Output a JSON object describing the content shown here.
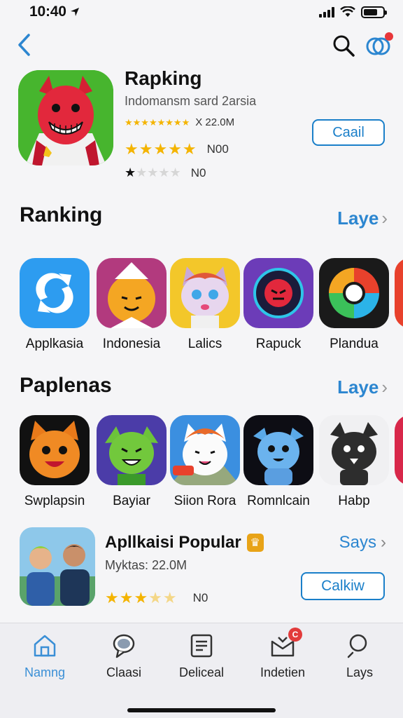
{
  "status": {
    "time": "10:40"
  },
  "featured": {
    "title": "Rapking",
    "subtitle": "Indomansm sard 2arsia",
    "meta_text": "X 22.0M",
    "rating_label": "N00",
    "rating2_label": "N0",
    "get_label": "Caail",
    "rating_value": 5
  },
  "section1": {
    "title": "Ranking",
    "link_label": "Laye",
    "apps": [
      {
        "label": "Applkasia",
        "icon": "refresh-icon"
      },
      {
        "label": "Indonesia",
        "icon": "tiger-icon"
      },
      {
        "label": "Lalics",
        "icon": "cat-icon"
      },
      {
        "label": "Rapuck",
        "icon": "mask-icon"
      },
      {
        "label": "Plandua",
        "icon": "swirl-icon"
      }
    ]
  },
  "section2": {
    "title": "Paplenas",
    "link_label": "Laye",
    "apps": [
      {
        "label": "Swplapsin",
        "icon": "fox-icon"
      },
      {
        "label": "Bayiar",
        "icon": "goblin-icon"
      },
      {
        "label": "Siion Rora",
        "icon": "kitten-icon"
      },
      {
        "label": "Romnlcain",
        "icon": "monster-icon"
      },
      {
        "label": "Habp",
        "icon": "bat-icon"
      }
    ]
  },
  "popular": {
    "title": "Apllkaisi Popular",
    "meta": "Myktas: 22.0M",
    "rating_label": "N0",
    "link_label": "Says",
    "button_label": "Calkiw",
    "rating_value": 3.5
  },
  "tabs": [
    {
      "label": "Namng",
      "icon": "home-icon",
      "active": true
    },
    {
      "label": "Claasi",
      "icon": "chat-icon",
      "active": false
    },
    {
      "label": "Deliceal",
      "icon": "list-icon",
      "active": false
    },
    {
      "label": "Indetien",
      "icon": "inbox-icon",
      "active": false,
      "badge": "C"
    },
    {
      "label": "Lays",
      "icon": "search-icon",
      "active": false
    }
  ],
  "colors": {
    "accent": "#2c86d0",
    "star": "#f4b400",
    "badge": "#e23b3b"
  }
}
